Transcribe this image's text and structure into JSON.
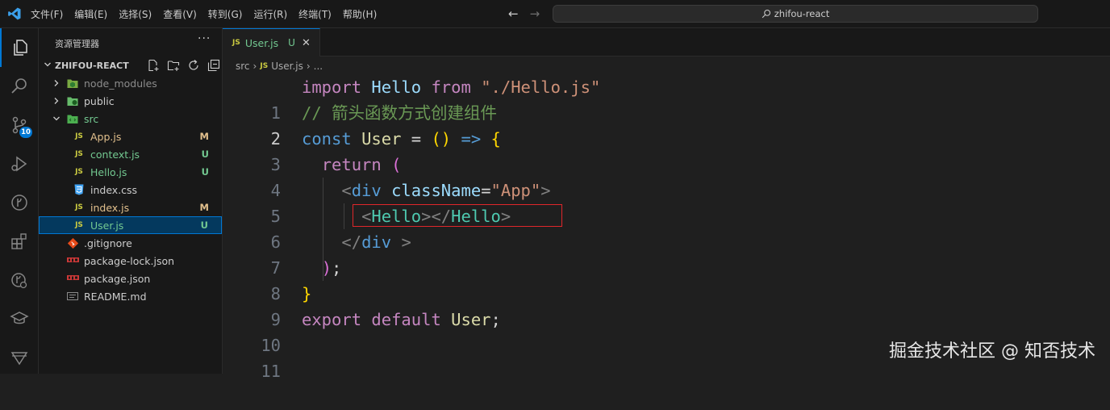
{
  "menu": [
    "文件(F)",
    "编辑(E)",
    "选择(S)",
    "查看(V)",
    "转到(G)",
    "运行(R)",
    "终端(T)",
    "帮助(H)"
  ],
  "search": {
    "text": "zhifou-react"
  },
  "activity_bar": {
    "items": [
      "explorer-icon",
      "search-icon",
      "source-control-icon",
      "run-debug-icon",
      "git-graph-icon",
      "extensions-icon",
      "remote-explorer-icon",
      "education-icon",
      "filter-icon"
    ],
    "badge": "10"
  },
  "sidebar": {
    "title": "资源管理器",
    "more": "···",
    "project": "ZHIFOU-REACT",
    "tree": [
      {
        "name": "node_modules",
        "type": "folder",
        "icon": "node-folder-icon",
        "status": ""
      },
      {
        "name": "public",
        "type": "folder",
        "icon": "public-folder-icon",
        "status": ""
      },
      {
        "name": "src",
        "type": "folder-open",
        "icon": "src-folder-icon",
        "status": "•"
      },
      {
        "name": "App.js",
        "type": "js",
        "icon": "JS",
        "status": "M"
      },
      {
        "name": "context.js",
        "type": "js",
        "icon": "JS",
        "status": "U"
      },
      {
        "name": "Hello.js",
        "type": "js",
        "icon": "JS",
        "status": "U"
      },
      {
        "name": "index.css",
        "type": "css",
        "icon": "css-icon",
        "status": ""
      },
      {
        "name": "index.js",
        "type": "js",
        "icon": "JS",
        "status": "M"
      },
      {
        "name": "User.js",
        "type": "js",
        "icon": "JS",
        "status": "U"
      },
      {
        "name": ".gitignore",
        "type": "git",
        "icon": "git-icon",
        "status": ""
      },
      {
        "name": "package-lock.json",
        "type": "npm",
        "icon": "npm-icon",
        "status": ""
      },
      {
        "name": "package.json",
        "type": "npm",
        "icon": "npm-icon",
        "status": ""
      },
      {
        "name": "README.md",
        "type": "md",
        "icon": "readme-icon",
        "status": ""
      }
    ]
  },
  "tab": {
    "icon": "JS",
    "name": "User.js",
    "status": "U",
    "close": "✕"
  },
  "breadcrumb": {
    "folder": "src",
    "icon": "JS",
    "file": "User.js",
    "more": "..."
  },
  "code": {
    "line_numbers": [
      "1",
      "2",
      "3",
      "4",
      "5",
      "6",
      "7",
      "8",
      "9",
      "10",
      "11"
    ],
    "l1": {
      "kw": "import",
      "name": "Hello",
      "from": "from",
      "str": "\"./Hello.js\""
    },
    "l2": {
      "comment": "// 箭头函数方式创建组件"
    },
    "l3": {
      "kw": "const",
      "name": "User",
      "eq": "=",
      "paren": "()",
      "arrow": "=>",
      "brace": "{"
    },
    "l4": {
      "kw": "return",
      "paren": "("
    },
    "l5": {
      "lt": "<",
      "tag": "div",
      "attr": "className",
      "eq": "=",
      "str": "\"App\"",
      "gt": ">"
    },
    "l6": {
      "lt": "<",
      "tag": "Hello",
      "mid": "></",
      "tag2": "Hello",
      "gt": ">"
    },
    "l7": {
      "lt": "</",
      "tag": "div",
      "gt": ">"
    },
    "l8": {
      "paren": ")",
      "semi": ";"
    },
    "l9": {
      "brace": "}"
    },
    "l10": {
      "kw1": "export",
      "kw2": "default",
      "name": "User",
      "semi": ";"
    }
  },
  "watermark": "掘金技术社区 @ 知否技术",
  "colors": {
    "accent": "#0078d4",
    "highlight": "#e0262a",
    "modified": "#e2c08d",
    "untracked": "#73c991"
  }
}
